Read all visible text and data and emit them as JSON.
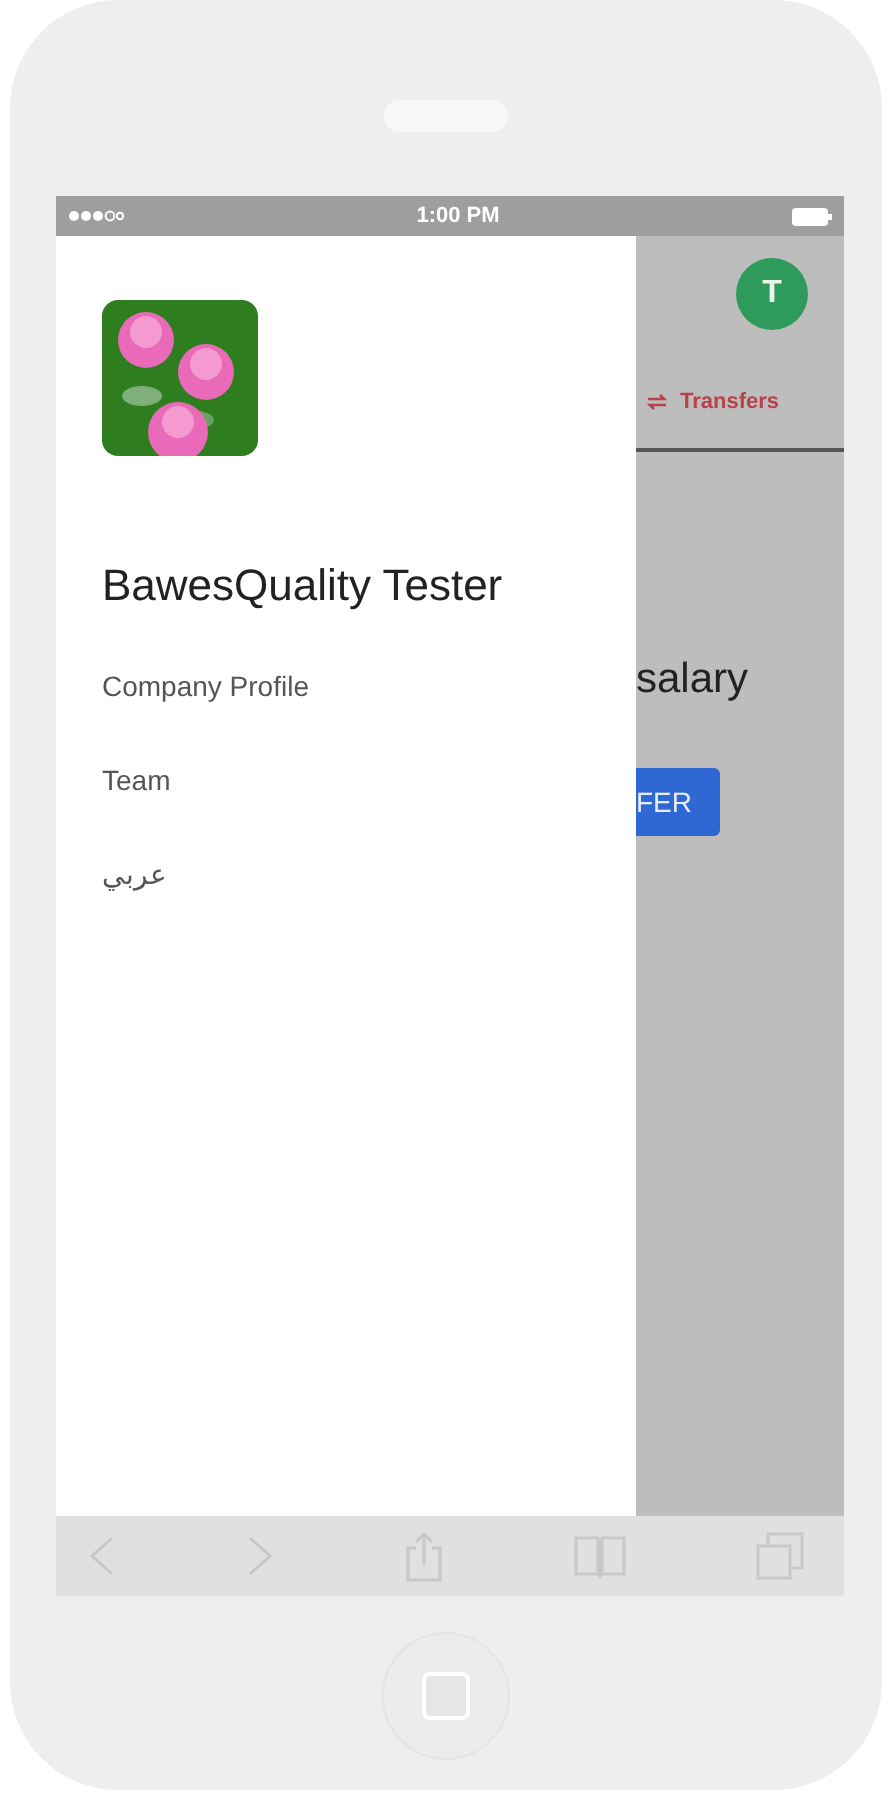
{
  "status_bar": {
    "time": "1:00 PM"
  },
  "drawer": {
    "title": "BawesQuality Tester",
    "items": [
      {
        "label": "Company Profile"
      },
      {
        "label": "Team"
      },
      {
        "label": "عربي"
      }
    ]
  },
  "background": {
    "avatar_initial": "T",
    "tab": {
      "label": "Transfers"
    },
    "heading": "salary",
    "button": "FER"
  }
}
